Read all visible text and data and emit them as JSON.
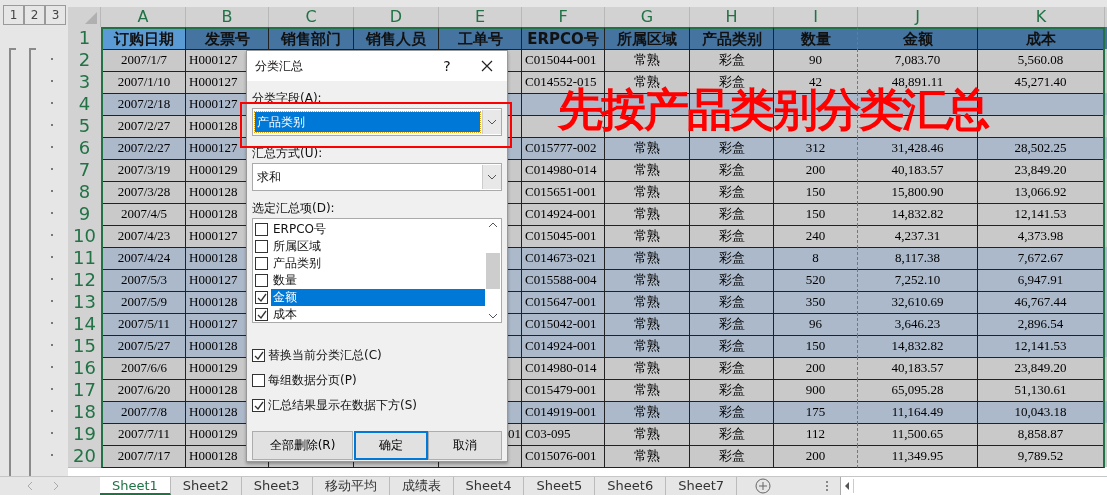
{
  "outline_levels": [
    {
      "label": "1"
    },
    {
      "label": "2"
    },
    {
      "label": "3"
    }
  ],
  "columns": [
    "A",
    "B",
    "C",
    "D",
    "E",
    "F",
    "G",
    "H",
    "I",
    "J",
    "K"
  ],
  "header": {
    "number": "1",
    "cells": [
      {
        "text": "订购日期",
        "selected": true
      },
      {
        "text": "发票号",
        "selected": false
      },
      {
        "text": "销售部门",
        "selected": false
      },
      {
        "text": "销售人员",
        "selected": false
      },
      {
        "text": "工单号",
        "selected": false
      },
      {
        "text": "ERPCO号",
        "selected": false
      },
      {
        "text": "所属区域",
        "selected": false
      },
      {
        "text": "产品类别",
        "selected": false
      },
      {
        "text": "数量",
        "selected": false
      },
      {
        "text": "金额",
        "selected": false
      },
      {
        "text": "成本",
        "selected": false
      }
    ]
  },
  "rows": [
    {
      "number": "2",
      "shaded": false,
      "cells": {
        "A": "2007/1/7",
        "B": "H000127",
        "F": "C015044-001",
        "G": "常熟",
        "H": "彩盒",
        "I": "90",
        "J": "7,083.70",
        "K": "5,560.08"
      }
    },
    {
      "number": "3",
      "shaded": false,
      "cells": {
        "A": "2007/1/10",
        "B": "H000127",
        "F": "C014552-015",
        "G": "常熟",
        "H": "彩盒",
        "I": "42",
        "J": "48,891.11",
        "K": "45,271.40"
      }
    },
    {
      "number": "4",
      "shaded": true,
      "cells": {
        "A": "2007/2/18",
        "B": "H000127"
      }
    },
    {
      "number": "5",
      "shaded": false,
      "cells": {
        "A": "2007/2/27",
        "B": "H000128"
      }
    },
    {
      "number": "6",
      "shaded": true,
      "cells": {
        "A": "2007/2/27",
        "B": "H000127",
        "F": "C015777-002",
        "G": "常熟",
        "H": "彩盒",
        "I": "312",
        "J": "31,428.46",
        "K": "28,502.25"
      }
    },
    {
      "number": "7",
      "shaded": false,
      "cells": {
        "A": "2007/3/19",
        "B": "H000129",
        "F": "C014980-014",
        "G": "常熟",
        "H": "彩盒",
        "I": "200",
        "J": "40,183.57",
        "K": "23,849.20"
      }
    },
    {
      "number": "8",
      "shaded": false,
      "cells": {
        "A": "2007/3/28",
        "B": "H000128",
        "F": "C015651-001",
        "G": "常熟",
        "H": "彩盒",
        "I": "150",
        "J": "15,800.90",
        "K": "13,066.92"
      }
    },
    {
      "number": "9",
      "shaded": false,
      "cells": {
        "A": "2007/4/5",
        "B": "H000128",
        "F": "C014924-001",
        "G": "常熟",
        "H": "彩盒",
        "I": "150",
        "J": "14,832.82",
        "K": "12,141.53"
      }
    },
    {
      "number": "10",
      "shaded": false,
      "cells": {
        "A": "2007/4/23",
        "B": "H000127",
        "F": "C015045-001",
        "G": "常熟",
        "H": "彩盒",
        "I": "240",
        "J": "4,237.31",
        "K": "4,373.98"
      }
    },
    {
      "number": "11",
      "shaded": true,
      "cells": {
        "A": "2007/4/24",
        "B": "H000128",
        "F": "C014673-021",
        "G": "常熟",
        "H": "彩盒",
        "I": "8",
        "J": "8,117.38",
        "K": "7,672.67"
      }
    },
    {
      "number": "12",
      "shaded": true,
      "cells": {
        "A": "2007/5/3",
        "B": "H000127",
        "F": "C015588-004",
        "G": "常熟",
        "H": "彩盒",
        "I": "520",
        "J": "7,252.10",
        "K": "6,947.91"
      }
    },
    {
      "number": "13",
      "shaded": true,
      "cells": {
        "A": "2007/5/9",
        "B": "H000128",
        "F": "C015647-001",
        "G": "常熟",
        "H": "彩盒",
        "I": "350",
        "J": "32,610.69",
        "K": "46,767.44"
      }
    },
    {
      "number": "14",
      "shaded": true,
      "cells": {
        "A": "2007/5/11",
        "B": "H000127",
        "F": "C015042-001",
        "G": "常熟",
        "H": "彩盒",
        "I": "96",
        "J": "3,646.23",
        "K": "2,896.54"
      }
    },
    {
      "number": "15",
      "shaded": true,
      "cells": {
        "A": "2007/5/27",
        "B": "H000128",
        "F": "C014924-001",
        "G": "常熟",
        "H": "彩盒",
        "I": "150",
        "J": "14,832.82",
        "K": "12,141.53"
      }
    },
    {
      "number": "16",
      "shaded": false,
      "cells": {
        "A": "2007/6/6",
        "B": "H000129",
        "F": "C014980-014",
        "G": "常熟",
        "H": "彩盒",
        "I": "200",
        "J": "40,183.57",
        "K": "23,849.20"
      }
    },
    {
      "number": "17",
      "shaded": false,
      "cells": {
        "A": "2007/6/20",
        "B": "H000128",
        "F": "C015479-001",
        "G": "常熟",
        "H": "彩盒",
        "I": "900",
        "J": "65,095.28",
        "K": "51,130.61"
      }
    },
    {
      "number": "18",
      "shaded": true,
      "cells": {
        "A": "2007/7/8",
        "B": "H000128",
        "F": "C014919-001",
        "G": "常熟",
        "H": "彩盒",
        "I": "175",
        "J": "11,164.49",
        "K": "10,043.18"
      }
    },
    {
      "number": "19",
      "shaded": false,
      "cells": {
        "A": "2007/7/11",
        "B": "H000129",
        "E": "01",
        "F": "C03-095",
        "G": "常熟",
        "H": "彩盒",
        "I": "112",
        "J": "11,500.65",
        "K": "8,858.87"
      }
    },
    {
      "number": "20",
      "shaded": false,
      "cells": {
        "A": "2007/7/17",
        "B": "H000128",
        "F": "C015076-001",
        "G": "常熟",
        "H": "彩盒",
        "I": "200",
        "J": "11,349.95",
        "K": "9,789.52"
      }
    }
  ],
  "dialog": {
    "title": "分类汇总",
    "help": "?",
    "group_by": {
      "label": "分类字段(A):",
      "value": "产品类别",
      "highlighted": true
    },
    "function": {
      "label": "汇总方式(U):",
      "value": "求和"
    },
    "add_to": {
      "label": "选定汇总项(D):",
      "items": [
        {
          "label": "ERPCO号",
          "checked": false,
          "selected": false
        },
        {
          "label": "所属区域",
          "checked": false,
          "selected": false
        },
        {
          "label": "产品类别",
          "checked": false,
          "selected": false
        },
        {
          "label": "数量",
          "checked": false,
          "selected": false
        },
        {
          "label": "金额",
          "checked": true,
          "selected": true
        },
        {
          "label": "成本",
          "checked": true,
          "selected": false
        }
      ]
    },
    "options": [
      {
        "label": "替换当前分类汇总(C)",
        "checked": true
      },
      {
        "label": "每组数据分页(P)",
        "checked": false
      },
      {
        "label": "汇总结果显示在数据下方(S)",
        "checked": true
      }
    ],
    "buttons": [
      {
        "label": "全部删除(R)",
        "default": false
      },
      {
        "label": "确定",
        "default": true
      },
      {
        "label": "取消",
        "default": false
      }
    ]
  },
  "annotation": {
    "text": "先按产品类别分类汇总"
  },
  "sheet_tabs": [
    {
      "label": "Sheet1",
      "selected": true
    },
    {
      "label": "Sheet2",
      "selected": false
    },
    {
      "label": "Sheet3",
      "selected": false
    },
    {
      "label": "移动平均",
      "selected": false
    },
    {
      "label": "成绩表",
      "selected": false
    },
    {
      "label": "Sheet4",
      "selected": false
    },
    {
      "label": "Sheet5",
      "selected": false
    },
    {
      "label": "Sheet6",
      "selected": false
    },
    {
      "label": "Sheet7",
      "selected": false
    }
  ]
}
